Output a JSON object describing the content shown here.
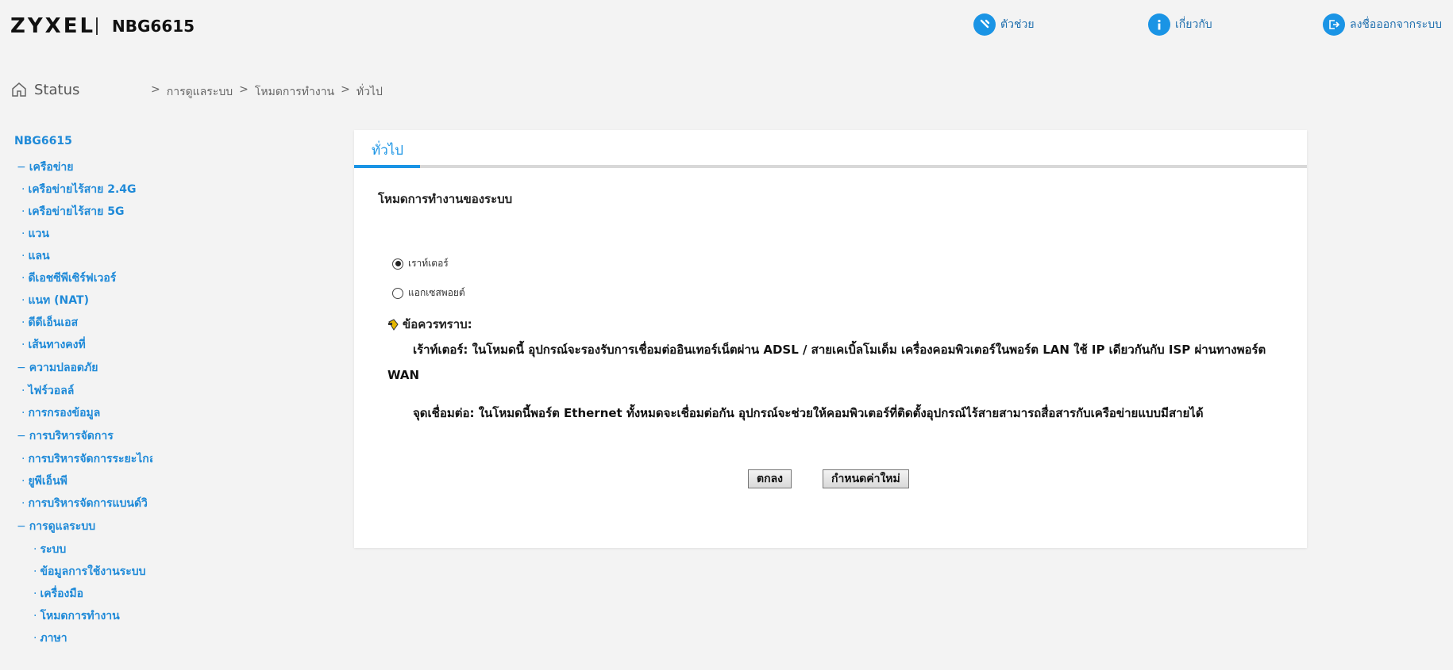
{
  "header": {
    "brand": "ZYXEL",
    "model": "NBG6615",
    "help_label": "ตัวช่วย",
    "help_icon": "wrench-icon",
    "about_label": "เกี่ยวกับ",
    "about_icon": "info-icon",
    "logout_label": "ลงชื่อออกจากระบบ",
    "logout_icon": "logout-icon",
    "accent": "#1a94e5"
  },
  "status": {
    "label": "Status",
    "icon": "home-icon"
  },
  "breadcrumb": {
    "separator": ">",
    "items": [
      "การดูแลระบบ",
      "โหมดการทำงาน",
      "ทั่วไป"
    ]
  },
  "sidebar": {
    "root": "NBG6615",
    "groups": [
      {
        "label": "เครือข่าย",
        "items": [
          "เครือข่ายไร้สาย 2.4G",
          "เครือข่ายไร้สาย 5G",
          "แวน",
          "แลน",
          "ดีเอชซีพีเซิร์ฟเวอร์",
          "แนท (NAT)",
          "ดีดีเอ็นเอส",
          "เส้นทางคงที่"
        ]
      },
      {
        "label": "ความปลอดภัย",
        "items": [
          "ไฟร์วอลล์",
          "การกรองข้อมูล"
        ]
      },
      {
        "label": "การบริหารจัดการ",
        "items": [
          "การบริหารจัดการระยะไกล",
          "ยูพีเอ็นพี",
          "การบริหารจัดการแบนด์วิ"
        ]
      },
      {
        "label": "การดูแลระบบ",
        "items": [
          "ระบบ",
          "ข้อมูลการใช้งานระบบ",
          "เครื่องมือ",
          "โหมดการทำงาน",
          "ภาษา"
        ]
      }
    ]
  },
  "panel": {
    "tab_label": "ทั่วไป",
    "section_title": "โหมดการทำงานของระบบ",
    "options": [
      {
        "label": "เราท์เตอร์",
        "selected": true
      },
      {
        "label": "แอกเซสพอยต์",
        "selected": false
      }
    ],
    "note_title": "ข้อควรทราบ:",
    "note_router": "เร้าท์เตอร์: ในโหมดนี้ อุปกรณ์จะรองรับการเชื่อมต่ออินเทอร์เน็ตผ่าน ADSL / สายเคเบิ้ลโมเด็ม เครื่องคอมพิวเตอร์ในพอร์ต LAN ใช้ IP เดียวกันกับ ISP ผ่านทางพอร์ต WAN",
    "note_ap": "จุดเชื่อมต่อ: ในโหมดนี้พอร์ต Ethernet ทั้งหมดจะเชื่อมต่อกัน อุปกรณ์จะช่วยให้คอมพิวเตอร์ที่ติดตั้งอุปกรณ์ไร้สายสามารถสื่อสารกับเครือข่ายแบบมีสายได้",
    "apply_label": "ตกลง",
    "reset_label": "กำหนดค่าใหม่"
  }
}
